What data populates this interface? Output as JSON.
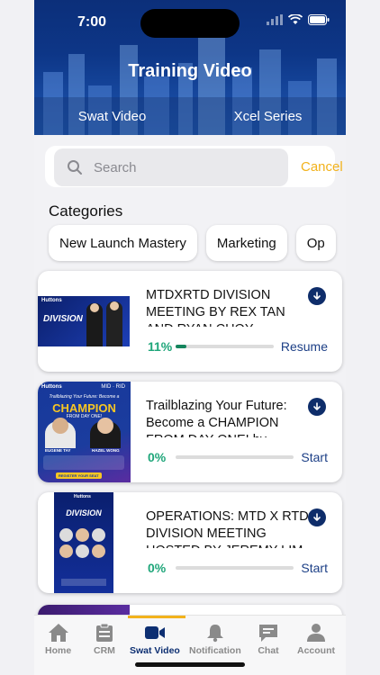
{
  "status_bar": {
    "time": "7:00"
  },
  "header": {
    "title": "Training Video",
    "tabs": [
      "Swat Video",
      "Xcel Series"
    ]
  },
  "search": {
    "placeholder": "Search",
    "cancel_label": "Cancel"
  },
  "categories": {
    "title": "Categories",
    "chips": [
      "New Launch Mastery",
      "Marketing",
      "Op"
    ]
  },
  "videos": [
    {
      "title": "MTDXRTD DIVISION MEETING By Rex Tan and Ryan Choy",
      "progress_pct": 11,
      "progress_label": "11%",
      "action": "Resume",
      "thumb": {
        "brand": "Huttons",
        "heading": "DIVISION"
      }
    },
    {
      "title": "Trailblazing Your Future: Become a CHAMPION FROM DAY ONE! by",
      "progress_pct": 0,
      "progress_label": "0%",
      "action": "Start",
      "thumb": {
        "brand": "Huttons",
        "tag": "MID · RID",
        "heading": "CHAMPION",
        "sub": "Trailblazing Your Future: Become a",
        "sub2": "FROM DAY ONE!",
        "person1": "EUGENE TAY",
        "person2": "HAZEL WONG",
        "cta": "REGISTER YOUR SEAT"
      }
    },
    {
      "title": "OPERATIONS: MTD X RTD DIVISION MEETING HOSTED BY JEREMY LIM",
      "progress_pct": 0,
      "progress_label": "0%",
      "action": "Start",
      "thumb": {
        "brand": "Huttons",
        "heading": "DIVISION"
      }
    }
  ],
  "bottom_nav": [
    {
      "label": "Home",
      "icon": "home-icon"
    },
    {
      "label": "CRM",
      "icon": "clipboard-icon"
    },
    {
      "label": "Swat Video",
      "icon": "video-camera-icon",
      "active": true
    },
    {
      "label": "Notification",
      "icon": "bell-icon"
    },
    {
      "label": "Chat",
      "icon": "chat-icon"
    },
    {
      "label": "Account",
      "icon": "person-icon"
    }
  ],
  "colors": {
    "header": "#0d3687",
    "accent": "#f2b21c",
    "progress": "#1fa67a",
    "nav_active": "#0d2f72"
  }
}
